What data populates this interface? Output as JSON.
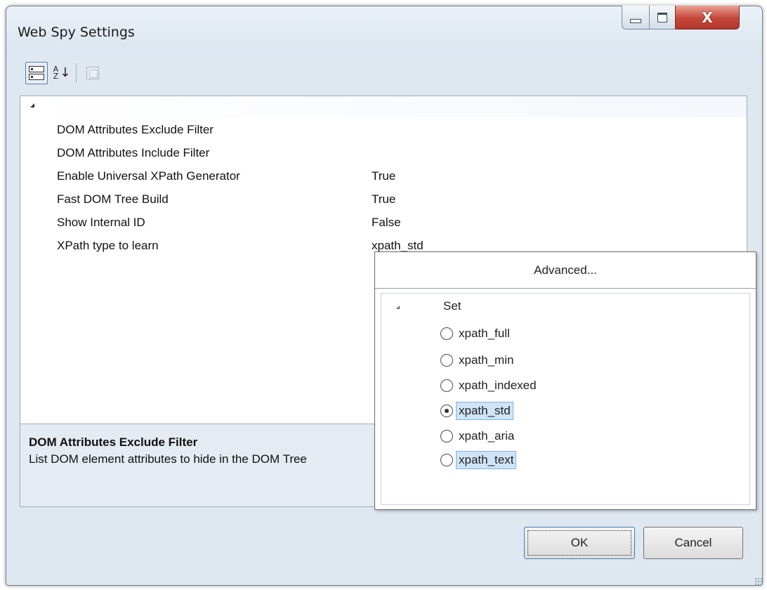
{
  "window": {
    "title": "Web Spy Settings",
    "close_glyph": "X"
  },
  "toolbar": {
    "categorized_icon": "categorized-view-icon",
    "alphabetical_icon": "sort-alphabetical-icon",
    "alphabetical_glyph_top": "A",
    "alphabetical_glyph_bottom": "Z",
    "alphabetical_arrow": "↓",
    "property_pages_icon": "property-pages-icon"
  },
  "grid": {
    "properties": [
      {
        "name": "DOM Attributes Exclude Filter",
        "value": ""
      },
      {
        "name": "DOM Attributes Include Filter",
        "value": ""
      },
      {
        "name": "Enable Universal XPath Generator",
        "value": "True"
      },
      {
        "name": "Fast DOM Tree Build",
        "value": "True"
      },
      {
        "name": "Show Internal ID",
        "value": "False"
      },
      {
        "name": "XPath type to learn",
        "value": "xpath_std"
      }
    ]
  },
  "description": {
    "title": "DOM Attributes Exclude Filter",
    "text": "List DOM element attributes to hide in the DOM Tree"
  },
  "dropdown": {
    "advanced_label": "Advanced...",
    "group_label": "Set",
    "options": [
      {
        "label": "xpath_full",
        "checked": false,
        "highlighted": false
      },
      {
        "label": "xpath_min",
        "checked": false,
        "highlighted": false
      },
      {
        "label": "xpath_indexed",
        "checked": false,
        "highlighted": false
      },
      {
        "label": "xpath_std",
        "checked": true,
        "highlighted": true
      },
      {
        "label": "xpath_aria",
        "checked": false,
        "highlighted": false
      },
      {
        "label": "xpath_text",
        "checked": false,
        "highlighted": true
      }
    ]
  },
  "buttons": {
    "ok": "OK",
    "cancel": "Cancel"
  },
  "colors": {
    "window_bg": "#dfe7f0",
    "close_button": "#c5463a",
    "selection": "#cfe4f7",
    "selection_border": "#7fb3e3"
  }
}
